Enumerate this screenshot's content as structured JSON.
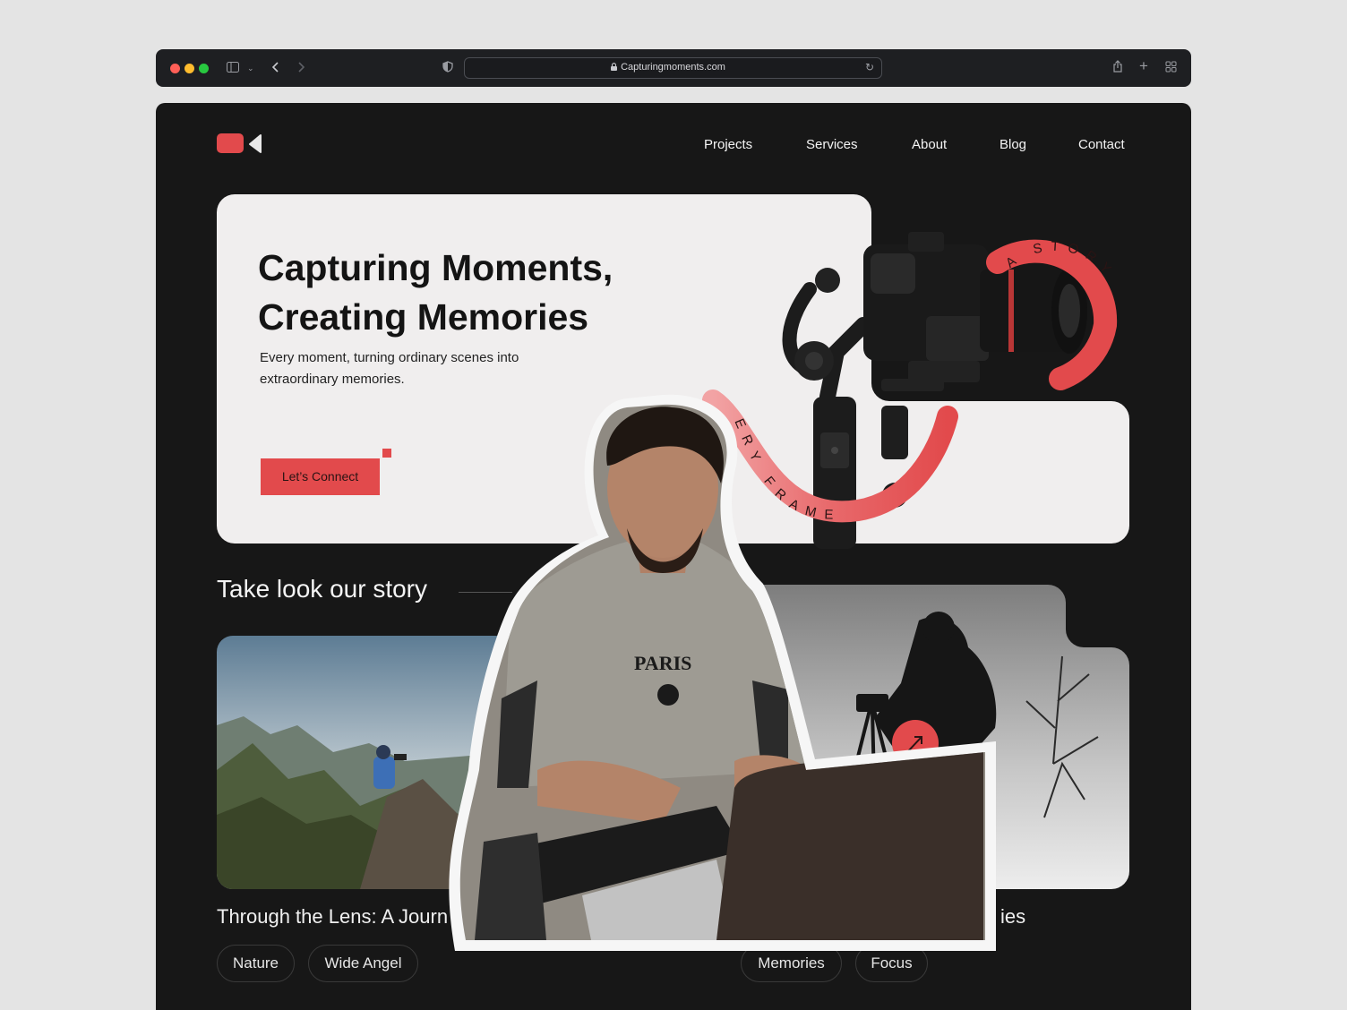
{
  "browser": {
    "url": "Capturingmoments.com",
    "traffic_lights": [
      "#ff5f57",
      "#febc2e",
      "#28c840"
    ]
  },
  "colors": {
    "accent": "#e24a4c",
    "page_bg": "#171717",
    "card_bg": "#f0eeee"
  },
  "nav": {
    "items": [
      "Projects",
      "Services",
      "About",
      "Blog",
      "Contact"
    ]
  },
  "hero": {
    "title_line1": "Capturing Moments,",
    "title_line2": "Creating Memories",
    "subtitle_line1": "Every moment, turning ordinary scenes into",
    "subtitle_line2": "extraordinary memories.",
    "cta_label": "Let’s Connect",
    "badge_text_top": "A STORY",
    "badge_text_bottom": "ERY FRAME"
  },
  "story": {
    "heading": "Take look our story",
    "cards": [
      {
        "title": "Through the Lens: A Journ",
        "tags": [
          "Nature",
          "Wide Angel"
        ]
      },
      {
        "title": "ies",
        "tags": [
          "Memories",
          "Focus"
        ]
      }
    ]
  }
}
